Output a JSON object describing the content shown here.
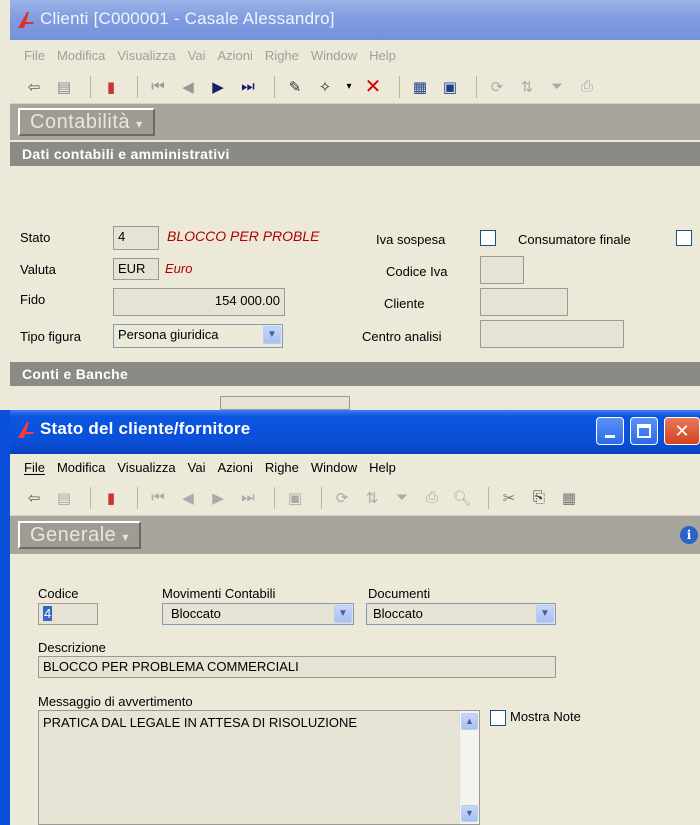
{
  "main_window": {
    "title": "Clienti [C000001 - Casale Alessandro]",
    "menu": [
      "File",
      "Modifica",
      "Visualizza",
      "Vai",
      "Azioni",
      "Righe",
      "Window",
      "Help"
    ],
    "section_tab": "Contabilità",
    "group1_header": "Dati contabili e amministrativi",
    "group2_header": "Conti e Banche",
    "fields": {
      "stato_label": "Stato",
      "stato_code": "4",
      "stato_desc": "BLOCCO PER PROBLE",
      "iva_sospesa_label": "Iva sospesa",
      "consumatore_finale_label": "Consumatore finale",
      "valuta_label": "Valuta",
      "valuta_code": "EUR",
      "valuta_desc": "Euro",
      "codice_iva_label": "Codice Iva",
      "codice_iva_value": "",
      "fido_label": "Fido",
      "fido_value": "154 000.00",
      "cliente_label": "Cliente",
      "cliente_value": "",
      "tipo_figura_label": "Tipo figura",
      "tipo_figura_value": "Persona giuridica",
      "centro_analisi_label": "Centro analisi",
      "centro_analisi_value": ""
    }
  },
  "dialog": {
    "title": "Stato del cliente/fornitore",
    "menu": [
      "File",
      "Modifica",
      "Visualizza",
      "Vai",
      "Azioni",
      "Righe",
      "Window",
      "Help"
    ],
    "section_tab": "Generale",
    "fields": {
      "codice_label": "Codice",
      "codice_value": "4",
      "movimenti_label": "Movimenti Contabili",
      "movimenti_value": "Bloccato",
      "documenti_label": "Documenti",
      "documenti_value": "Bloccato",
      "descrizione_label": "Descrizione",
      "descrizione_value": "BLOCCO PER PROBLEMA COMMERCIALI",
      "messaggio_label": "Messaggio di avvertimento",
      "messaggio_value": "PRATICA DAL LEGALE IN ATTESA DI RISOLUZIONE",
      "mostra_note_label": "Mostra Note"
    }
  },
  "colors": {
    "accent_red": "#b00000",
    "titlebar_active": "#0a55e0",
    "titlebar_inactive": "#7f9be0"
  }
}
